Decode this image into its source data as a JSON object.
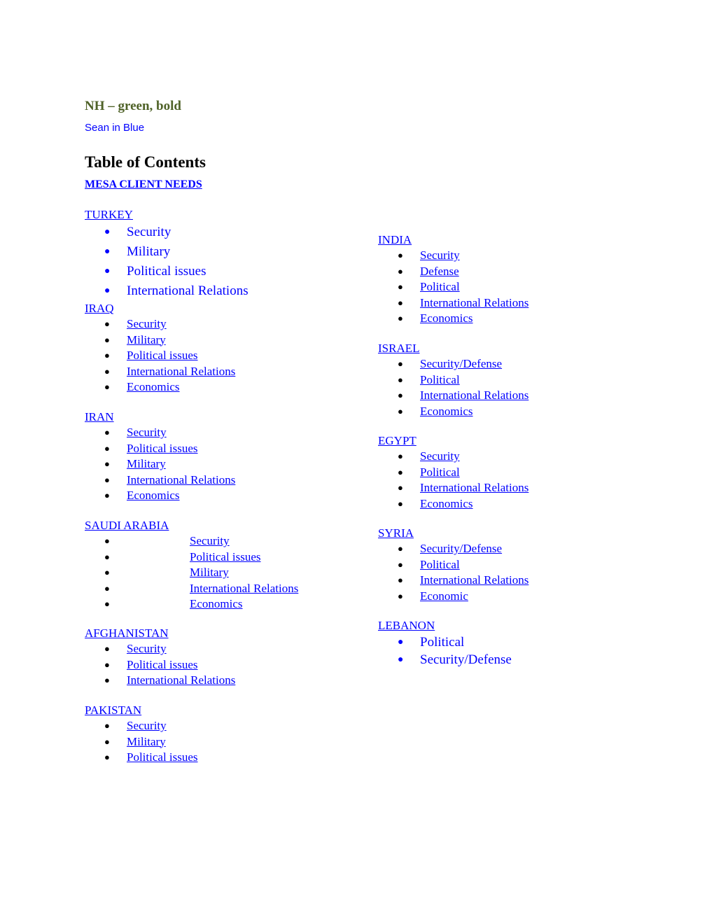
{
  "header": {
    "nh_note": "NH – green, bold",
    "sean_note": "Sean in Blue",
    "toc_title": "Table of Contents",
    "mesa_link": "MESA CLIENT NEEDS"
  },
  "colors": {
    "link": "#0000ff",
    "nh_green": "#4f6228"
  },
  "sections": {
    "turkey": {
      "name": "TURKEY",
      "items": [
        "Security",
        "Military",
        "Political issues",
        "International Relations"
      ]
    },
    "iraq": {
      "name": "IRAQ",
      "items": [
        "Security",
        "Military",
        "Political issues",
        "International Relations",
        "Economics"
      ]
    },
    "iran": {
      "name": "IRAN",
      "items": [
        "Security",
        "Political issues",
        "Military",
        "International Relations",
        "Economics"
      ]
    },
    "saudi": {
      "name": "SAUDI ARABIA",
      "items": [
        "Security",
        "Political issues",
        "Military",
        "International Relations",
        "Economics"
      ]
    },
    "afghanistan": {
      "name": "AFGHANISTAN",
      "items": [
        "Security",
        "Political issues",
        "International Relations"
      ]
    },
    "pakistan": {
      "name": "PAKISTAN",
      "items": [
        "Security",
        "Military",
        "Political issues"
      ]
    },
    "india": {
      "name": "INDIA",
      "items": [
        "Security",
        "Defense",
        "Political",
        "International Relations",
        "Economics"
      ]
    },
    "israel": {
      "name": "ISRAEL",
      "items": [
        "Security/Defense",
        "Political",
        "International Relations",
        "Economics"
      ]
    },
    "egypt": {
      "name": "EGYPT",
      "items": [
        "Security",
        "Political",
        "International Relations",
        "Economics"
      ]
    },
    "syria": {
      "name": "SYRIA",
      "items": [
        "Security/Defense",
        "Political",
        "International Relations",
        "Economic"
      ]
    },
    "lebanon": {
      "name": "LEBANON",
      "items": [
        "Political",
        "Security/Defense"
      ]
    }
  }
}
